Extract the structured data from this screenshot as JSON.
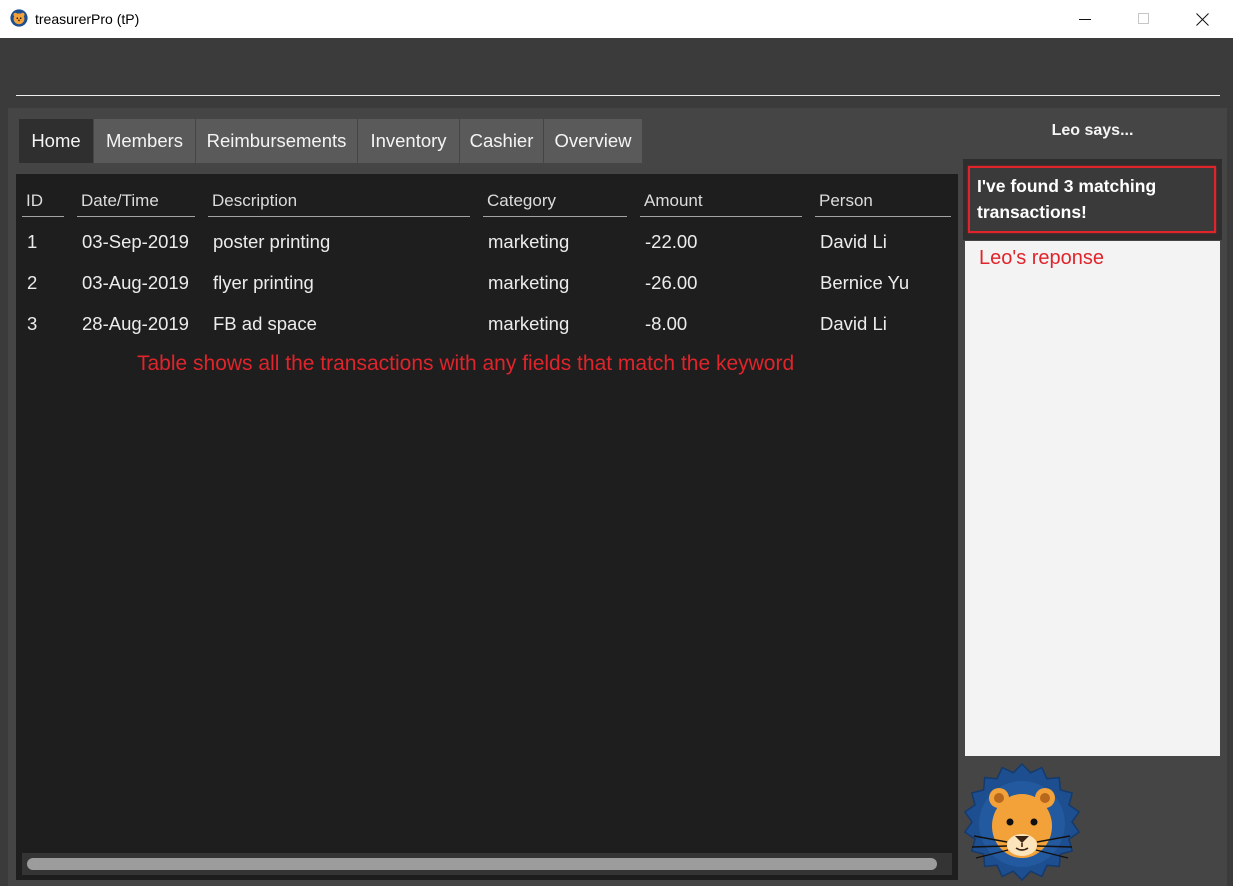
{
  "window": {
    "title": "treasurerPro (tP)",
    "icons": {
      "app": "lion-icon",
      "minimize": "minimize-icon",
      "maximize": "maximize-icon",
      "close": "close-icon",
      "mascot": "lion-mascot"
    }
  },
  "command_box": {
    "value": "",
    "placeholder": ""
  },
  "tabs": [
    {
      "label": "Home",
      "selected": true
    },
    {
      "label": "Members",
      "selected": false
    },
    {
      "label": "Reimbursements",
      "selected": false
    },
    {
      "label": "Inventory",
      "selected": false
    },
    {
      "label": "Cashier",
      "selected": false
    },
    {
      "label": "Overview",
      "selected": false
    }
  ],
  "table": {
    "columns": [
      "ID",
      "Date/Time",
      "Description",
      "Category",
      "Amount",
      "Person"
    ],
    "rows": [
      [
        "1",
        "03-Sep-2019",
        "poster printing",
        "marketing",
        "-22.00",
        "David Li"
      ],
      [
        "2",
        "03-Aug-2019",
        "flyer printing",
        "marketing",
        "-26.00",
        "Bernice Yu"
      ],
      [
        "3",
        "28-Aug-2019",
        "FB ad space",
        "marketing",
        "-8.00",
        "David Li"
      ]
    ]
  },
  "leo": {
    "title": "Leo says...",
    "message": "I've found 3 matching transactions!"
  },
  "annotations": {
    "table_note": "Table shows all the transactions with any fields that match the keyword",
    "response_note": "Leo's reponse"
  },
  "colors": {
    "annotation-red": "#e0242b",
    "leo-mane-blue": "#1d4e8f",
    "leo-face-orange": "#f3a23a"
  }
}
